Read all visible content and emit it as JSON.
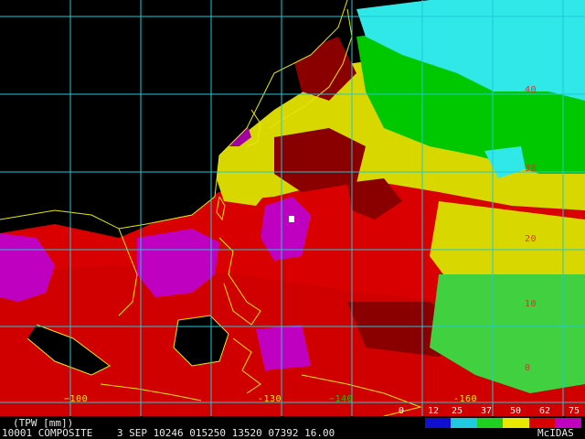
{
  "map": {
    "product_label": "(TPW [mm])",
    "status_line": "10001 COMPOSITE    3 SEP 10246 015250 13520 07392 16.00",
    "brand": "McIDAS",
    "longitude_labels": [
      "100",
      "-130",
      "140",
      "-160"
    ],
    "latitude_labels": [
      "40",
      "30",
      "20",
      "10",
      "0"
    ],
    "colors": {
      "background": "#000000",
      "grid": "#20c8d8",
      "coast": "#e8e800",
      "very_moist": "#c000c0",
      "moist": "#d80000",
      "dark_moist": "#8a0000",
      "medium": "#d8d800",
      "dry": "#00c800",
      "very_dry": "#30e8e8"
    },
    "legend": {
      "ticks": [
        "0",
        "12",
        "25",
        "37",
        "50",
        "62",
        "75"
      ],
      "swatches": [
        "#000000",
        "#1010d0",
        "#20c8e0",
        "#20d020",
        "#e8e800",
        "#d80000",
        "#c000c0"
      ]
    }
  }
}
